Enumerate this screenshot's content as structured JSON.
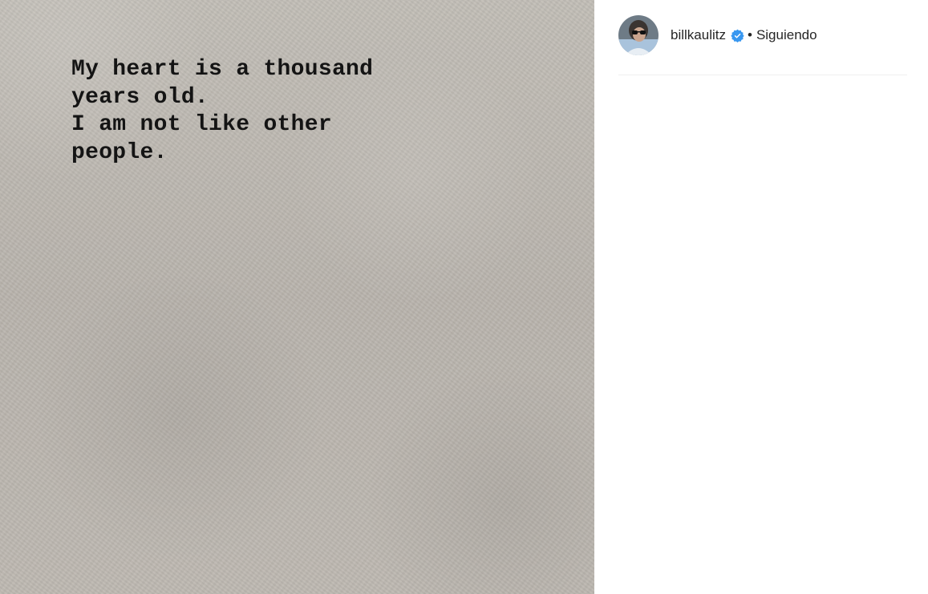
{
  "post": {
    "quote_lines": [
      "My heart is a thousand",
      "years old.",
      "I am not like other",
      "people."
    ]
  },
  "header": {
    "username": "billkaulitz",
    "separator": "•",
    "follow_status": "Siguiendo",
    "verified_icon": "verified-badge-icon"
  },
  "colors": {
    "verified_blue": "#3897f0",
    "text": "#262626",
    "divider": "#efefef",
    "paper": "#bdb8b1"
  }
}
